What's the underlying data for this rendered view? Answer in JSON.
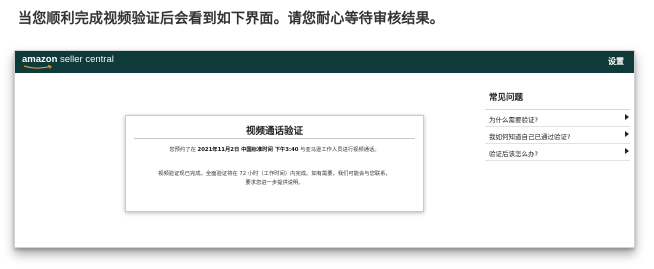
{
  "instruction": "当您顺利完成视频验证后会看到如下界面。请您耐心等待审核结果。",
  "header": {
    "logo_brand": "amazon",
    "logo_sub": " seller central",
    "settings_label": "设置"
  },
  "card": {
    "title": "视频通话验证",
    "line1_prefix": "您预约了在 ",
    "line1_datetime": "2021年11月2日 中国标准时间 下午3:40",
    "line1_suffix": " 与亚马逊工作人员进行视频通话。",
    "line2": "视频验证现已完成。全面验证将在 72 小时（工作时间）内完成。如有需要，我们可能会与您联系，",
    "line3": "要求您进一步提供说明。"
  },
  "faq": {
    "title": "常见问题",
    "items": [
      {
        "label": "为什么需要验证?"
      },
      {
        "label": "我如何知道自己已通过验证?"
      },
      {
        "label": "验证后该怎么办?"
      }
    ]
  },
  "colors": {
    "topbar": "#0f3a3a",
    "logo_smile": "#f2a23a"
  }
}
